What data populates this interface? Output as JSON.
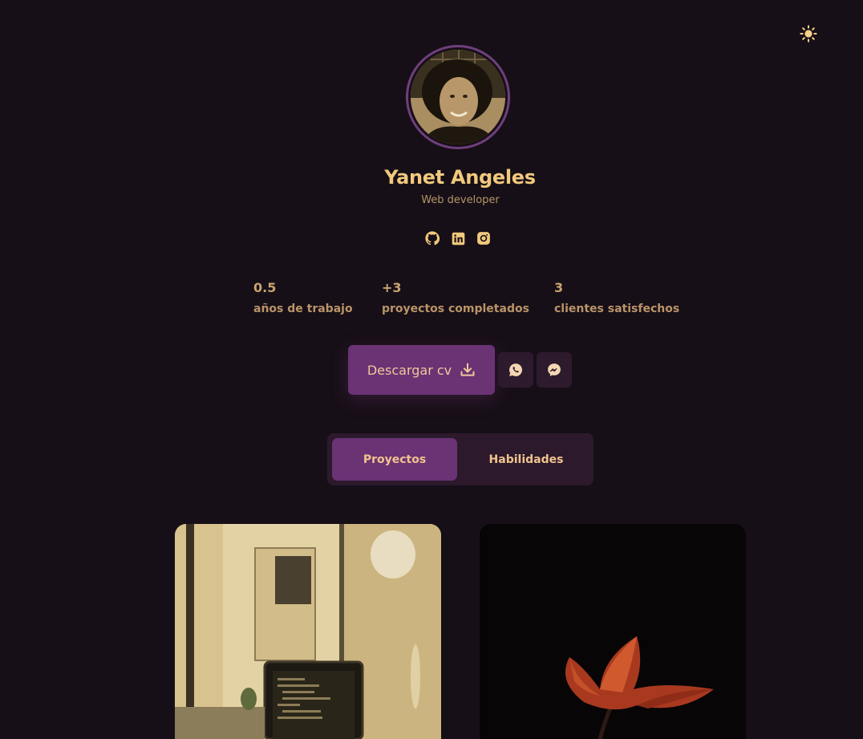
{
  "profile": {
    "name": "Yanet Angeles",
    "role": "Web developer"
  },
  "socials": [
    {
      "icon": "github-icon"
    },
    {
      "icon": "linkedin-icon"
    },
    {
      "icon": "instagram-icon"
    }
  ],
  "stats": [
    {
      "value": "0.5",
      "label": "años de trabajo"
    },
    {
      "value": "+3",
      "label": "proyectos completados"
    },
    {
      "value": "3",
      "label": "clientes satisfechos"
    }
  ],
  "actions": {
    "cv_label": "Descargar cv",
    "cv_icon": "download-icon",
    "whatsapp_icon": "whatsapp-icon",
    "messenger_icon": "messenger-icon"
  },
  "tabs": [
    {
      "label": "Proyectos",
      "active": true
    },
    {
      "label": "Habilidades",
      "active": false
    }
  ],
  "theme": {
    "toggle_icon": "sun-icon",
    "background": "#170f17",
    "accent": "#6a3374",
    "text_primary": "#f1c97d",
    "text_muted": "#b99468"
  },
  "projects": [
    {
      "image": "workspace-laptop-photo"
    },
    {
      "image": "red-tulip-photo"
    }
  ]
}
